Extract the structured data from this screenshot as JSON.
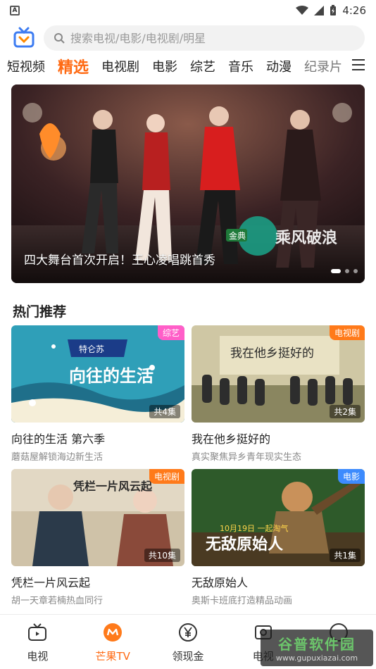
{
  "status_bar": {
    "time": "4:26"
  },
  "search": {
    "placeholder": "搜索电视/电影/电视剧/明星"
  },
  "tabs": [
    {
      "label": "短视频"
    },
    {
      "label": "精选"
    },
    {
      "label": "电视剧"
    },
    {
      "label": "电影"
    },
    {
      "label": "综艺"
    },
    {
      "label": "音乐"
    },
    {
      "label": "动漫"
    },
    {
      "label": "纪录片"
    }
  ],
  "banner": {
    "caption": "四大舞台首次开启！王心凌唱跳首秀",
    "logo_text": "乘风破浪",
    "logo_tag": "金典"
  },
  "section": {
    "title": "热门推荐"
  },
  "cards": [
    {
      "title": "向往的生活 第六季",
      "subtitle": "蘑菇屋解锁海边新生活",
      "badge": "综艺",
      "badge_color": "#ff5ec8",
      "episodes": "共4集",
      "art_text": "向往的生活",
      "art_sub": "特仑苏"
    },
    {
      "title": "我在他乡挺好的",
      "subtitle": "真实聚焦异乡青年现实生态",
      "badge": "电视剧",
      "badge_color": "#ff7a1a",
      "episodes": "共2集",
      "art_text": "我在他乡挺好的"
    },
    {
      "title": "凭栏一片风云起",
      "subtitle": "胡一天章若楠热血同行",
      "badge": "电视剧",
      "badge_color": "#ff7a1a",
      "episodes": "共10集",
      "art_text": "凭栏一片风云起"
    },
    {
      "title": "无敌原始人",
      "subtitle": "奥斯卡班底打造精品动画",
      "badge": "电影",
      "badge_color": "#3d8bfd",
      "episodes": "共1集",
      "art_text": "无敌原始人",
      "art_date": "10月19日 一起淘气"
    }
  ],
  "bottom_nav": [
    {
      "label": "电视",
      "icon": "tv-icon"
    },
    {
      "label": "芒果TV",
      "icon": "mango-icon"
    },
    {
      "label": "领现金",
      "icon": "yen-icon"
    },
    {
      "label": "电视",
      "icon": "screen-icon"
    }
  ],
  "watermark": {
    "line1": "谷普软件园",
    "line2": "www.gupuxiazai.com"
  },
  "colors": {
    "accent": "#ff6a13",
    "search_bg": "#f2f2f2"
  }
}
